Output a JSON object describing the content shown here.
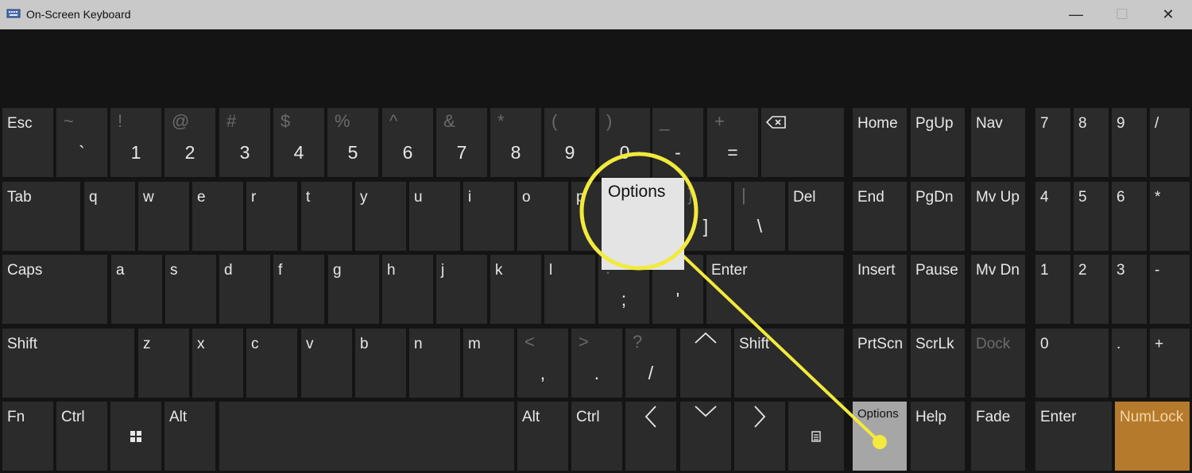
{
  "window": {
    "title": "On-Screen Keyboard",
    "minimize": "—",
    "restore": "☐",
    "close": "✕"
  },
  "rows": {
    "number": [
      {
        "label": "Esc"
      },
      {
        "shift": "~",
        "main": "`"
      },
      {
        "shift": "!",
        "main": "1"
      },
      {
        "shift": "@",
        "main": "2"
      },
      {
        "shift": "#",
        "main": "3"
      },
      {
        "shift": "$",
        "main": "4"
      },
      {
        "shift": "%",
        "main": "5"
      },
      {
        "shift": "^",
        "main": "6"
      },
      {
        "shift": "&",
        "main": "7"
      },
      {
        "shift": "*",
        "main": "8"
      },
      {
        "shift": "(",
        "main": "9"
      },
      {
        "shift": ")",
        "main": "0"
      },
      {
        "shift": "_",
        "main": "-"
      },
      {
        "shift": "+",
        "main": "="
      },
      {
        "icon": "backspace-icon"
      }
    ],
    "q": [
      {
        "label": "Tab"
      },
      {
        "label": "q"
      },
      {
        "label": "w"
      },
      {
        "label": "e"
      },
      {
        "label": "r"
      },
      {
        "label": "t"
      },
      {
        "label": "y"
      },
      {
        "label": "u"
      },
      {
        "label": "i"
      },
      {
        "label": "o"
      },
      {
        "label": "p"
      },
      {
        "shift": "{",
        "main": "["
      },
      {
        "shift": "}",
        "main": "]"
      },
      {
        "shift": "|",
        "main": "\\"
      },
      {
        "label": "Del"
      }
    ],
    "a": [
      {
        "label": "Caps"
      },
      {
        "label": "a"
      },
      {
        "label": "s"
      },
      {
        "label": "d"
      },
      {
        "label": "f"
      },
      {
        "label": "g"
      },
      {
        "label": "h"
      },
      {
        "label": "j"
      },
      {
        "label": "k"
      },
      {
        "label": "l"
      },
      {
        "shift": ":",
        "main": ";"
      },
      {
        "shift": "\"",
        "main": "'"
      },
      {
        "label": "Enter"
      }
    ],
    "z": [
      {
        "label": "Shift"
      },
      {
        "label": "z"
      },
      {
        "label": "x"
      },
      {
        "label": "c"
      },
      {
        "label": "v"
      },
      {
        "label": "b"
      },
      {
        "label": "n"
      },
      {
        "label": "m"
      },
      {
        "shift": "<",
        "main": ","
      },
      {
        "shift": ">",
        "main": "."
      },
      {
        "shift": "?",
        "main": "/"
      },
      {
        "icon": "arrow-up-icon"
      },
      {
        "label": "Shift"
      }
    ],
    "bottom": [
      {
        "label": "Fn"
      },
      {
        "label": "Ctrl"
      },
      {
        "icon": "windows-icon"
      },
      {
        "label": "Alt"
      },
      {
        "label": ""
      },
      {
        "label": "Alt"
      },
      {
        "label": "Ctrl"
      },
      {
        "icon": "arrow-left-icon"
      },
      {
        "icon": "arrow-down-icon"
      },
      {
        "icon": "arrow-right-icon"
      },
      {
        "icon": "menu-icon"
      }
    ]
  },
  "nav": [
    {
      "label": "Home"
    },
    {
      "label": "PgUp"
    },
    {
      "label": "Nav"
    },
    {
      "label": "End"
    },
    {
      "label": "PgDn"
    },
    {
      "label": "Mv Up"
    },
    {
      "label": "Insert"
    },
    {
      "label": "Pause"
    },
    {
      "label": "Mv Dn"
    },
    {
      "label": "PrtScn"
    },
    {
      "label": "ScrLk"
    },
    {
      "label": "Dock"
    },
    {
      "label": "Options"
    },
    {
      "label": "Help"
    },
    {
      "label": "Fade"
    }
  ],
  "numpad": [
    {
      "label": "7"
    },
    {
      "label": "8"
    },
    {
      "label": "9"
    },
    {
      "label": "/"
    },
    {
      "label": "4"
    },
    {
      "label": "5"
    },
    {
      "label": "6"
    },
    {
      "label": "*"
    },
    {
      "label": "1"
    },
    {
      "label": "2"
    },
    {
      "label": "3"
    },
    {
      "label": "-"
    },
    {
      "label": "0"
    },
    {
      "label": "."
    },
    {
      "label": "+"
    },
    {
      "label": "Enter"
    },
    {
      "label": "NumLock"
    }
  ],
  "callout": {
    "label": "Options",
    "color": "#f2ea3c"
  }
}
